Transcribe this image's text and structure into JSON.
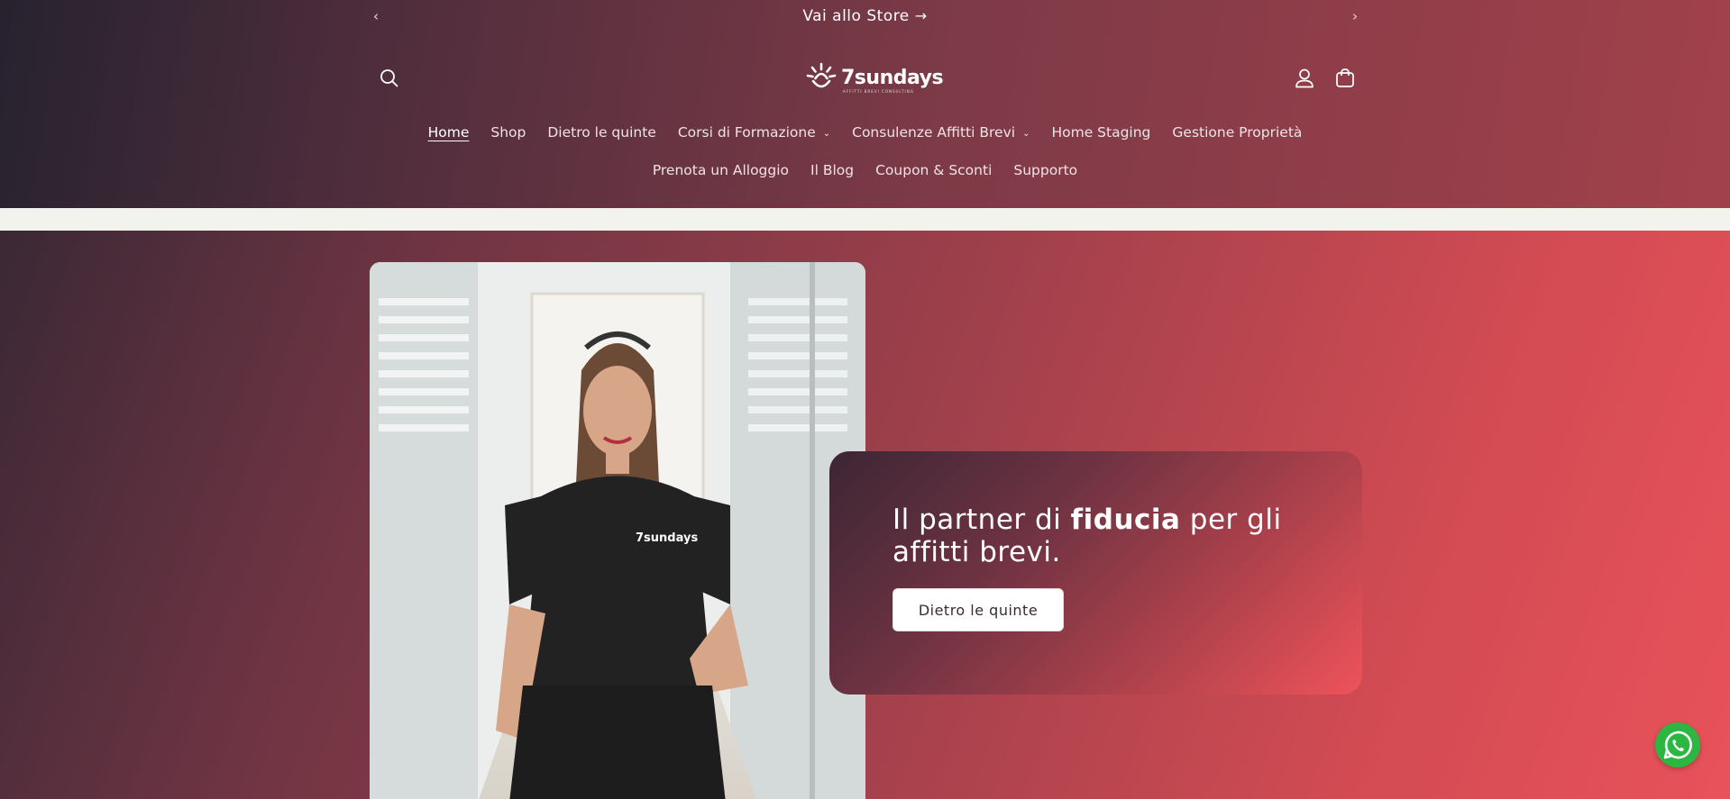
{
  "announcement": {
    "text": "Vai allo Store",
    "arrow": "→",
    "prev_icon": "chevron-left-icon",
    "next_icon": "chevron-right-icon"
  },
  "header": {
    "logo_text": "7sundays",
    "logo_tagline": "AFFITTI BREVI CONSULTING",
    "icons": [
      "search-icon",
      "account-icon",
      "cart-icon"
    ]
  },
  "nav": {
    "row1": [
      {
        "label": "Home",
        "active": true
      },
      {
        "label": "Shop"
      },
      {
        "label": "Dietro le quinte"
      },
      {
        "label": "Corsi di Formazione",
        "dropdown": true
      },
      {
        "label": "Consulenze Affitti Brevi",
        "dropdown": true
      },
      {
        "label": "Home Staging"
      },
      {
        "label": "Gestione Proprietà"
      }
    ],
    "row2": [
      {
        "label": "Prenota un Alloggio"
      },
      {
        "label": "Il Blog"
      },
      {
        "label": "Coupon & Sconti"
      },
      {
        "label": "Supporto"
      }
    ],
    "caret": "⌄"
  },
  "hero": {
    "heading_pre": "Il partner di ",
    "heading_bold": "fiducia",
    "heading_post": " per gli affitti brevi.",
    "button_label": "Dietro le quinte",
    "photo_shirt_logo": "7sundays"
  },
  "colors": {
    "header_gradient_start": "#27222f",
    "header_gradient_end": "#a2414b",
    "hero_gradient_end": "#e9525a",
    "button_bg": "#ffffff",
    "whatsapp": "#2bb741"
  },
  "floating": {
    "icon": "whatsapp-icon"
  }
}
